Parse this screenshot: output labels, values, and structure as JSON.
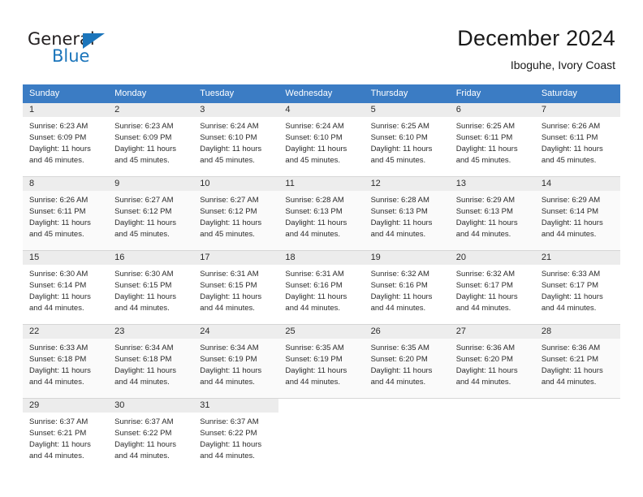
{
  "brand": {
    "name_primary": "General",
    "name_secondary": "Blue",
    "triangle_icon": "triangle-icon",
    "accent_color": "#1b75bb"
  },
  "header": {
    "title": "December 2024",
    "subtitle": "Iboguhe, Ivory Coast"
  },
  "calendar": {
    "header_color": "#3b7cc4",
    "weekday_headers": [
      "Sunday",
      "Monday",
      "Tuesday",
      "Wednesday",
      "Thursday",
      "Friday",
      "Saturday"
    ],
    "weeks": [
      {
        "shaded": false,
        "days": [
          {
            "day": "1",
            "sunrise": "Sunrise: 6:23 AM",
            "sunset": "Sunset: 6:09 PM",
            "daylight_line1": "Daylight: 11 hours",
            "daylight_line2": "and 46 minutes."
          },
          {
            "day": "2",
            "sunrise": "Sunrise: 6:23 AM",
            "sunset": "Sunset: 6:09 PM",
            "daylight_line1": "Daylight: 11 hours",
            "daylight_line2": "and 45 minutes."
          },
          {
            "day": "3",
            "sunrise": "Sunrise: 6:24 AM",
            "sunset": "Sunset: 6:10 PM",
            "daylight_line1": "Daylight: 11 hours",
            "daylight_line2": "and 45 minutes."
          },
          {
            "day": "4",
            "sunrise": "Sunrise: 6:24 AM",
            "sunset": "Sunset: 6:10 PM",
            "daylight_line1": "Daylight: 11 hours",
            "daylight_line2": "and 45 minutes."
          },
          {
            "day": "5",
            "sunrise": "Sunrise: 6:25 AM",
            "sunset": "Sunset: 6:10 PM",
            "daylight_line1": "Daylight: 11 hours",
            "daylight_line2": "and 45 minutes."
          },
          {
            "day": "6",
            "sunrise": "Sunrise: 6:25 AM",
            "sunset": "Sunset: 6:11 PM",
            "daylight_line1": "Daylight: 11 hours",
            "daylight_line2": "and 45 minutes."
          },
          {
            "day": "7",
            "sunrise": "Sunrise: 6:26 AM",
            "sunset": "Sunset: 6:11 PM",
            "daylight_line1": "Daylight: 11 hours",
            "daylight_line2": "and 45 minutes."
          }
        ]
      },
      {
        "shaded": true,
        "days": [
          {
            "day": "8",
            "sunrise": "Sunrise: 6:26 AM",
            "sunset": "Sunset: 6:11 PM",
            "daylight_line1": "Daylight: 11 hours",
            "daylight_line2": "and 45 minutes."
          },
          {
            "day": "9",
            "sunrise": "Sunrise: 6:27 AM",
            "sunset": "Sunset: 6:12 PM",
            "daylight_line1": "Daylight: 11 hours",
            "daylight_line2": "and 45 minutes."
          },
          {
            "day": "10",
            "sunrise": "Sunrise: 6:27 AM",
            "sunset": "Sunset: 6:12 PM",
            "daylight_line1": "Daylight: 11 hours",
            "daylight_line2": "and 45 minutes."
          },
          {
            "day": "11",
            "sunrise": "Sunrise: 6:28 AM",
            "sunset": "Sunset: 6:13 PM",
            "daylight_line1": "Daylight: 11 hours",
            "daylight_line2": "and 44 minutes."
          },
          {
            "day": "12",
            "sunrise": "Sunrise: 6:28 AM",
            "sunset": "Sunset: 6:13 PM",
            "daylight_line1": "Daylight: 11 hours",
            "daylight_line2": "and 44 minutes."
          },
          {
            "day": "13",
            "sunrise": "Sunrise: 6:29 AM",
            "sunset": "Sunset: 6:13 PM",
            "daylight_line1": "Daylight: 11 hours",
            "daylight_line2": "and 44 minutes."
          },
          {
            "day": "14",
            "sunrise": "Sunrise: 6:29 AM",
            "sunset": "Sunset: 6:14 PM",
            "daylight_line1": "Daylight: 11 hours",
            "daylight_line2": "and 44 minutes."
          }
        ]
      },
      {
        "shaded": false,
        "days": [
          {
            "day": "15",
            "sunrise": "Sunrise: 6:30 AM",
            "sunset": "Sunset: 6:14 PM",
            "daylight_line1": "Daylight: 11 hours",
            "daylight_line2": "and 44 minutes."
          },
          {
            "day": "16",
            "sunrise": "Sunrise: 6:30 AM",
            "sunset": "Sunset: 6:15 PM",
            "daylight_line1": "Daylight: 11 hours",
            "daylight_line2": "and 44 minutes."
          },
          {
            "day": "17",
            "sunrise": "Sunrise: 6:31 AM",
            "sunset": "Sunset: 6:15 PM",
            "daylight_line1": "Daylight: 11 hours",
            "daylight_line2": "and 44 minutes."
          },
          {
            "day": "18",
            "sunrise": "Sunrise: 6:31 AM",
            "sunset": "Sunset: 6:16 PM",
            "daylight_line1": "Daylight: 11 hours",
            "daylight_line2": "and 44 minutes."
          },
          {
            "day": "19",
            "sunrise": "Sunrise: 6:32 AM",
            "sunset": "Sunset: 6:16 PM",
            "daylight_line1": "Daylight: 11 hours",
            "daylight_line2": "and 44 minutes."
          },
          {
            "day": "20",
            "sunrise": "Sunrise: 6:32 AM",
            "sunset": "Sunset: 6:17 PM",
            "daylight_line1": "Daylight: 11 hours",
            "daylight_line2": "and 44 minutes."
          },
          {
            "day": "21",
            "sunrise": "Sunrise: 6:33 AM",
            "sunset": "Sunset: 6:17 PM",
            "daylight_line1": "Daylight: 11 hours",
            "daylight_line2": "and 44 minutes."
          }
        ]
      },
      {
        "shaded": true,
        "days": [
          {
            "day": "22",
            "sunrise": "Sunrise: 6:33 AM",
            "sunset": "Sunset: 6:18 PM",
            "daylight_line1": "Daylight: 11 hours",
            "daylight_line2": "and 44 minutes."
          },
          {
            "day": "23",
            "sunrise": "Sunrise: 6:34 AM",
            "sunset": "Sunset: 6:18 PM",
            "daylight_line1": "Daylight: 11 hours",
            "daylight_line2": "and 44 minutes."
          },
          {
            "day": "24",
            "sunrise": "Sunrise: 6:34 AM",
            "sunset": "Sunset: 6:19 PM",
            "daylight_line1": "Daylight: 11 hours",
            "daylight_line2": "and 44 minutes."
          },
          {
            "day": "25",
            "sunrise": "Sunrise: 6:35 AM",
            "sunset": "Sunset: 6:19 PM",
            "daylight_line1": "Daylight: 11 hours",
            "daylight_line2": "and 44 minutes."
          },
          {
            "day": "26",
            "sunrise": "Sunrise: 6:35 AM",
            "sunset": "Sunset: 6:20 PM",
            "daylight_line1": "Daylight: 11 hours",
            "daylight_line2": "and 44 minutes."
          },
          {
            "day": "27",
            "sunrise": "Sunrise: 6:36 AM",
            "sunset": "Sunset: 6:20 PM",
            "daylight_line1": "Daylight: 11 hours",
            "daylight_line2": "and 44 minutes."
          },
          {
            "day": "28",
            "sunrise": "Sunrise: 6:36 AM",
            "sunset": "Sunset: 6:21 PM",
            "daylight_line1": "Daylight: 11 hours",
            "daylight_line2": "and 44 minutes."
          }
        ]
      },
      {
        "shaded": false,
        "days": [
          {
            "day": "29",
            "sunrise": "Sunrise: 6:37 AM",
            "sunset": "Sunset: 6:21 PM",
            "daylight_line1": "Daylight: 11 hours",
            "daylight_line2": "and 44 minutes."
          },
          {
            "day": "30",
            "sunrise": "Sunrise: 6:37 AM",
            "sunset": "Sunset: 6:22 PM",
            "daylight_line1": "Daylight: 11 hours",
            "daylight_line2": "and 44 minutes."
          },
          {
            "day": "31",
            "sunrise": "Sunrise: 6:37 AM",
            "sunset": "Sunset: 6:22 PM",
            "daylight_line1": "Daylight: 11 hours",
            "daylight_line2": "and 44 minutes."
          },
          {
            "day": "",
            "sunrise": "",
            "sunset": "",
            "daylight_line1": "",
            "daylight_line2": ""
          },
          {
            "day": "",
            "sunrise": "",
            "sunset": "",
            "daylight_line1": "",
            "daylight_line2": ""
          },
          {
            "day": "",
            "sunrise": "",
            "sunset": "",
            "daylight_line1": "",
            "daylight_line2": ""
          },
          {
            "day": "",
            "sunrise": "",
            "sunset": "",
            "daylight_line1": "",
            "daylight_line2": ""
          }
        ]
      }
    ]
  }
}
